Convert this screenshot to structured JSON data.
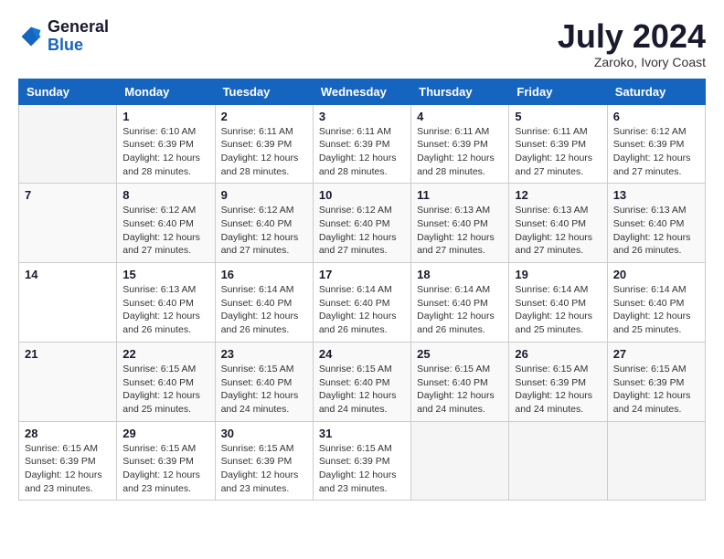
{
  "header": {
    "logo_general": "General",
    "logo_blue": "Blue",
    "month_title": "July 2024",
    "subtitle": "Zaroko, Ivory Coast"
  },
  "days_of_week": [
    "Sunday",
    "Monday",
    "Tuesday",
    "Wednesday",
    "Thursday",
    "Friday",
    "Saturday"
  ],
  "weeks": [
    [
      {
        "day": "",
        "info": ""
      },
      {
        "day": "1",
        "info": "Sunrise: 6:10 AM\nSunset: 6:39 PM\nDaylight: 12 hours\nand 28 minutes."
      },
      {
        "day": "2",
        "info": "Sunrise: 6:11 AM\nSunset: 6:39 PM\nDaylight: 12 hours\nand 28 minutes."
      },
      {
        "day": "3",
        "info": "Sunrise: 6:11 AM\nSunset: 6:39 PM\nDaylight: 12 hours\nand 28 minutes."
      },
      {
        "day": "4",
        "info": "Sunrise: 6:11 AM\nSunset: 6:39 PM\nDaylight: 12 hours\nand 28 minutes."
      },
      {
        "day": "5",
        "info": "Sunrise: 6:11 AM\nSunset: 6:39 PM\nDaylight: 12 hours\nand 27 minutes."
      },
      {
        "day": "6",
        "info": "Sunrise: 6:12 AM\nSunset: 6:39 PM\nDaylight: 12 hours\nand 27 minutes."
      }
    ],
    [
      {
        "day": "7",
        "info": ""
      },
      {
        "day": "8",
        "info": "Sunrise: 6:12 AM\nSunset: 6:40 PM\nDaylight: 12 hours\nand 27 minutes."
      },
      {
        "day": "9",
        "info": "Sunrise: 6:12 AM\nSunset: 6:40 PM\nDaylight: 12 hours\nand 27 minutes."
      },
      {
        "day": "10",
        "info": "Sunrise: 6:12 AM\nSunset: 6:40 PM\nDaylight: 12 hours\nand 27 minutes."
      },
      {
        "day": "11",
        "info": "Sunrise: 6:13 AM\nSunset: 6:40 PM\nDaylight: 12 hours\nand 27 minutes."
      },
      {
        "day": "12",
        "info": "Sunrise: 6:13 AM\nSunset: 6:40 PM\nDaylight: 12 hours\nand 27 minutes."
      },
      {
        "day": "13",
        "info": "Sunrise: 6:13 AM\nSunset: 6:40 PM\nDaylight: 12 hours\nand 26 minutes."
      }
    ],
    [
      {
        "day": "14",
        "info": ""
      },
      {
        "day": "15",
        "info": "Sunrise: 6:13 AM\nSunset: 6:40 PM\nDaylight: 12 hours\nand 26 minutes."
      },
      {
        "day": "16",
        "info": "Sunrise: 6:14 AM\nSunset: 6:40 PM\nDaylight: 12 hours\nand 26 minutes."
      },
      {
        "day": "17",
        "info": "Sunrise: 6:14 AM\nSunset: 6:40 PM\nDaylight: 12 hours\nand 26 minutes."
      },
      {
        "day": "18",
        "info": "Sunrise: 6:14 AM\nSunset: 6:40 PM\nDaylight: 12 hours\nand 26 minutes."
      },
      {
        "day": "19",
        "info": "Sunrise: 6:14 AM\nSunset: 6:40 PM\nDaylight: 12 hours\nand 25 minutes."
      },
      {
        "day": "20",
        "info": "Sunrise: 6:14 AM\nSunset: 6:40 PM\nDaylight: 12 hours\nand 25 minutes."
      }
    ],
    [
      {
        "day": "21",
        "info": ""
      },
      {
        "day": "22",
        "info": "Sunrise: 6:15 AM\nSunset: 6:40 PM\nDaylight: 12 hours\nand 25 minutes."
      },
      {
        "day": "23",
        "info": "Sunrise: 6:15 AM\nSunset: 6:40 PM\nDaylight: 12 hours\nand 24 minutes."
      },
      {
        "day": "24",
        "info": "Sunrise: 6:15 AM\nSunset: 6:40 PM\nDaylight: 12 hours\nand 24 minutes."
      },
      {
        "day": "25",
        "info": "Sunrise: 6:15 AM\nSunset: 6:40 PM\nDaylight: 12 hours\nand 24 minutes."
      },
      {
        "day": "26",
        "info": "Sunrise: 6:15 AM\nSunset: 6:39 PM\nDaylight: 12 hours\nand 24 minutes."
      },
      {
        "day": "27",
        "info": "Sunrise: 6:15 AM\nSunset: 6:39 PM\nDaylight: 12 hours\nand 24 minutes."
      }
    ],
    [
      {
        "day": "28",
        "info": "Sunrise: 6:15 AM\nSunset: 6:39 PM\nDaylight: 12 hours\nand 23 minutes."
      },
      {
        "day": "29",
        "info": "Sunrise: 6:15 AM\nSunset: 6:39 PM\nDaylight: 12 hours\nand 23 minutes."
      },
      {
        "day": "30",
        "info": "Sunrise: 6:15 AM\nSunset: 6:39 PM\nDaylight: 12 hours\nand 23 minutes."
      },
      {
        "day": "31",
        "info": "Sunrise: 6:15 AM\nSunset: 6:39 PM\nDaylight: 12 hours\nand 23 minutes."
      },
      {
        "day": "",
        "info": ""
      },
      {
        "day": "",
        "info": ""
      },
      {
        "day": "",
        "info": ""
      }
    ]
  ]
}
